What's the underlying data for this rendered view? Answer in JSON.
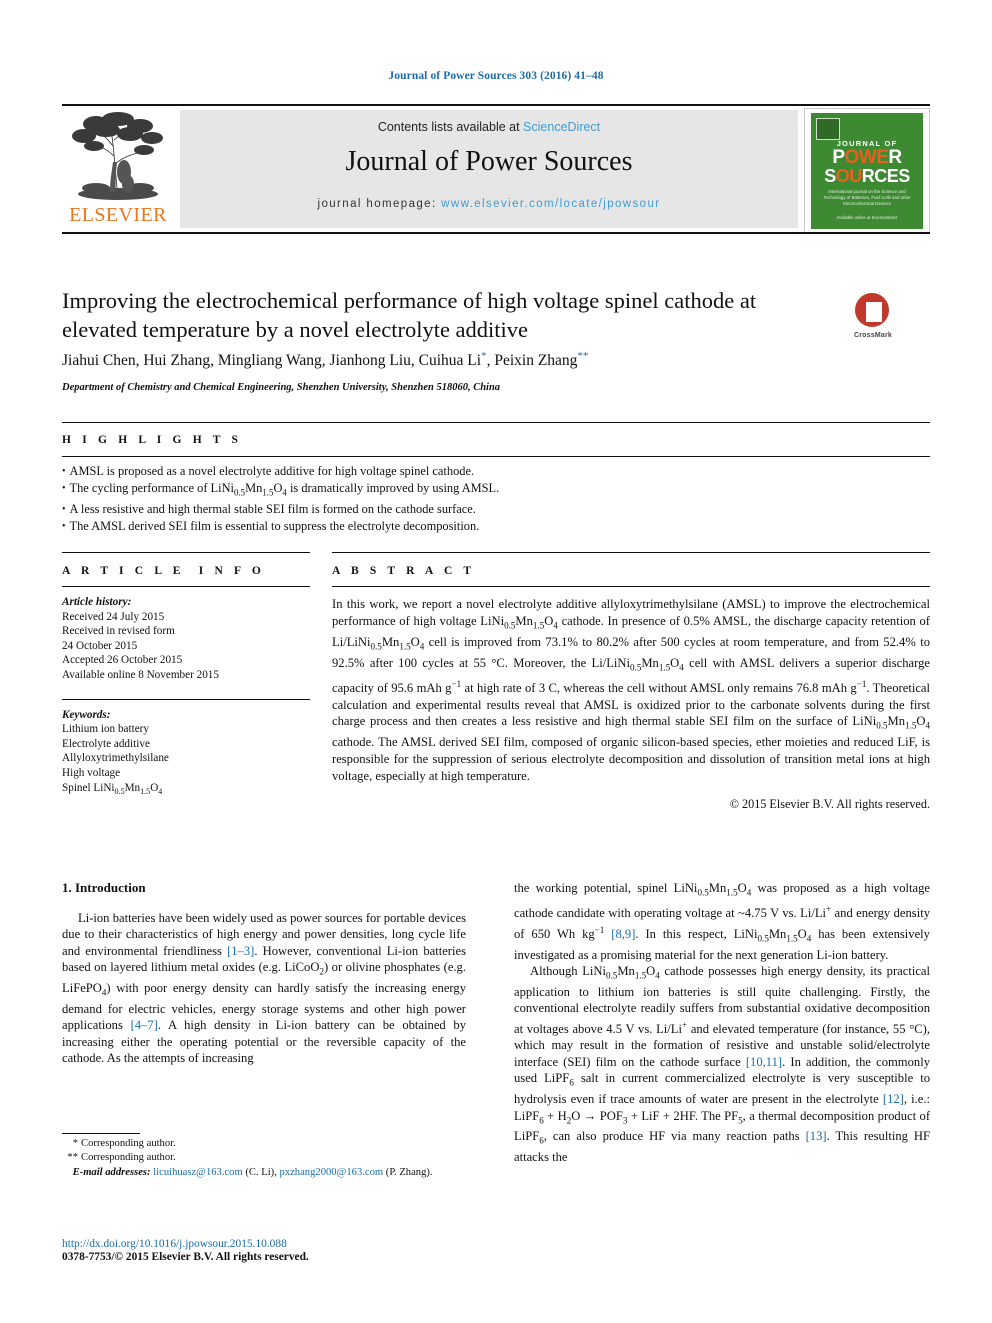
{
  "running_head": "Journal of Power Sources 303 (2016) 41–48",
  "masthead": {
    "publisher_word": "ELSEVIER",
    "contents_prefix": "Contents lists available at ",
    "contents_link": "ScienceDirect",
    "journal_title": "Journal of Power Sources",
    "homepage_label": "journal homepage: ",
    "homepage_url": "www.elsevier.com/locate/jpowsour",
    "cover": {
      "line_journal_of": "JOURNAL OF",
      "line_power": "POWER",
      "line_sources": "SOURCES",
      "blurb": "International journal on the Science and Technology of Batteries, Fuel Cells and other Electrochemical Devices",
      "footer": "Available online at\nScienceDirect",
      "bg_color": "#3e8a33",
      "accent_color": "#e8601c"
    }
  },
  "article": {
    "title": "Improving the electrochemical performance of high voltage spinel cathode at elevated temperature by a novel electrolyte additive",
    "authors_plain": "Jiahui Chen, Hui Zhang, Mingliang Wang, Jianhong Liu, Cuihua Li",
    "authors": [
      {
        "name": "Jiahui Chen",
        "mark": ""
      },
      {
        "name": "Hui Zhang",
        "mark": ""
      },
      {
        "name": "Mingliang Wang",
        "mark": ""
      },
      {
        "name": "Jianhong Liu",
        "mark": ""
      },
      {
        "name": "Cuihua Li",
        "mark": "*"
      },
      {
        "name": "Peixin Zhang",
        "mark": "**"
      }
    ],
    "affiliation": "Department of Chemistry and Chemical Engineering, Shenzhen University, Shenzhen 518060, China",
    "crossmark_label": "CrossMark"
  },
  "highlights": {
    "label": "HIGHLIGHTS",
    "items": [
      "AMSL is proposed as a novel electrolyte additive for high voltage spinel cathode.",
      "The cycling performance of LiNi0.5Mn1.5O4 is dramatically improved by using AMSL.",
      "A less resistive and high thermal stable SEI film is formed on the cathode surface.",
      "The AMSL derived SEI film is essential to suppress the electrolyte decomposition."
    ]
  },
  "article_info": {
    "label": "ARTICLE INFO",
    "history_label": "Article history:",
    "history": [
      "Received 24 July 2015",
      "Received in revised form",
      "24 October 2015",
      "Accepted 26 October 2015",
      "Available online 8 November 2015"
    ],
    "keywords_label": "Keywords:",
    "keywords": [
      "Lithium ion battery",
      "Electrolyte additive",
      "Allyloxytrimethylsilane",
      "High voltage",
      "Spinel LiNi0.5Mn1.5O4"
    ]
  },
  "abstract": {
    "label": "ABSTRACT",
    "copyright": "© 2015 Elsevier B.V. All rights reserved."
  },
  "body": {
    "section_heading": "1. Introduction"
  },
  "footnotes": {
    "corresponding_1_mark": "*",
    "corresponding_1": "Corresponding author.",
    "corresponding_2_mark": "**",
    "corresponding_2": "Corresponding author.",
    "email_label": "E-mail addresses:",
    "email_1": "licuihuasz@163.com",
    "email_1_owner": "(C. Li)",
    "email_2": "pxzhang2000@163.com",
    "email_2_owner": "(P. Zhang)."
  },
  "doi": {
    "url": "http://dx.doi.org/10.1016/j.jpowsour.2015.10.088",
    "issn_line": "0378-7753/© 2015 Elsevier B.V. All rights reserved."
  },
  "colors": {
    "link": "#1b6ca8",
    "elsevier_orange": "#e87722",
    "banner_grey": "#e6e6e6"
  }
}
